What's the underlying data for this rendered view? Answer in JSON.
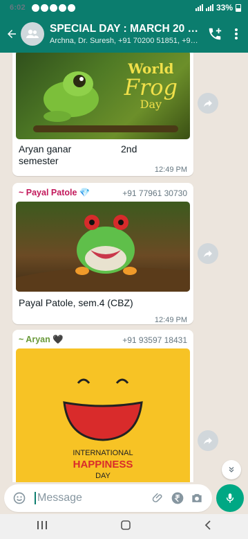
{
  "status": {
    "time": "6:02",
    "battery": "33%"
  },
  "header": {
    "title": "SPECIAL DAY : MARCH 20 20...",
    "subtitle": "Archna, Dr. Suresh, +91 70200 51851, +91..."
  },
  "messages": [
    {
      "image_title_line1": "World",
      "image_title_line2": "Frog",
      "image_title_line3": "Day",
      "caption_left": "Aryan ganar",
      "caption_right": "2nd",
      "caption_line2": "semester",
      "time": "12:49 PM"
    },
    {
      "sender": "~ Payal Patole 💎",
      "phone": "+91 77961 30730",
      "caption": "Payal Patole, sem.4 (CBZ)",
      "time": "12:49 PM"
    },
    {
      "sender": "~ Aryan 🖤",
      "phone": "+91 93597 18431",
      "image_text_line1": "INTERNATIONAL",
      "image_text_line2": "HAPPINESS",
      "image_text_line3": "DAY"
    }
  ],
  "input": {
    "placeholder": "Message"
  },
  "colors": {
    "header": "#0b7d6e",
    "payal_name": "#c2185b",
    "aryan_name": "#6a9a3a",
    "mic": "#00a884"
  }
}
